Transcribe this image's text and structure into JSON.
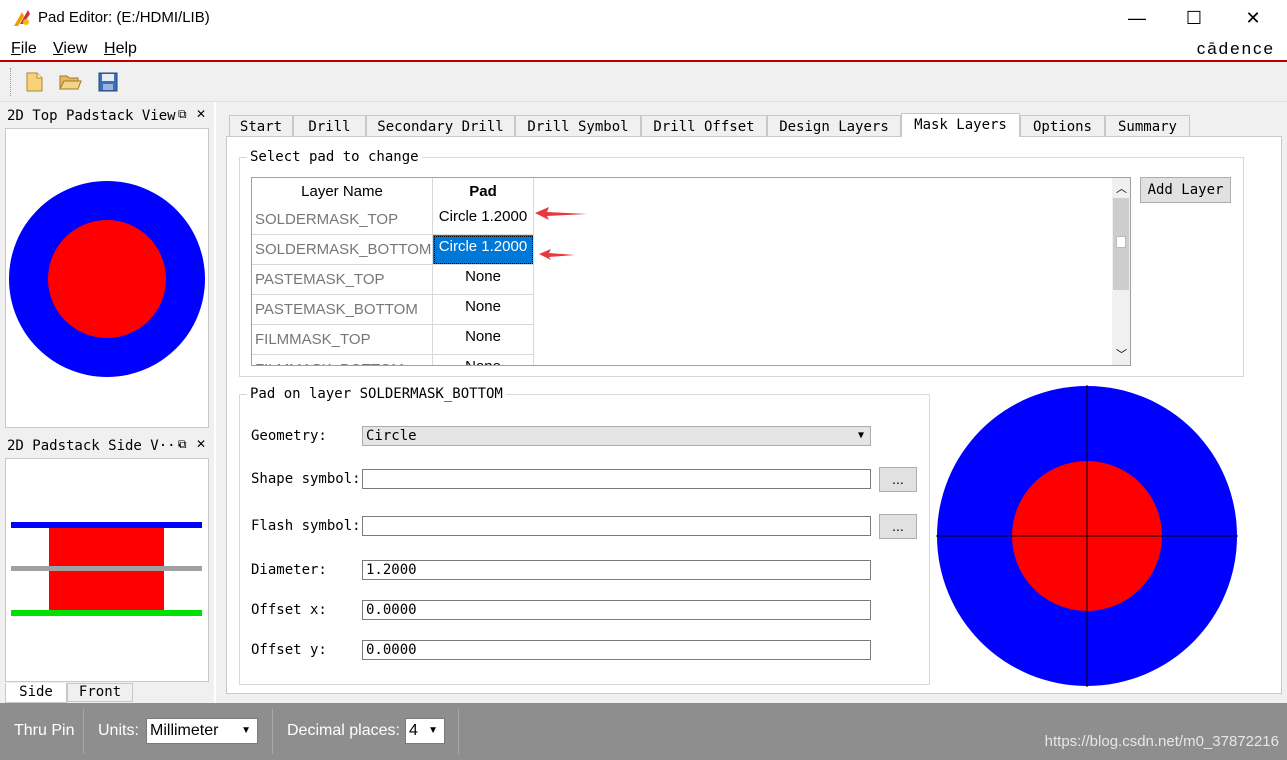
{
  "window": {
    "title": "Pad Editor:  (E:/HDMI/LIB)",
    "minimize_glyph": "—",
    "maximize_glyph": "☐",
    "close_glyph": "✕"
  },
  "menu": {
    "items": [
      {
        "mnemonic": "F",
        "rest": "ile"
      },
      {
        "mnemonic": "V",
        "rest": "iew"
      },
      {
        "mnemonic": "H",
        "rest": "elp"
      }
    ],
    "brand": "cādence"
  },
  "toolbar": {
    "icons": [
      "new-file-icon",
      "open-folder-icon",
      "save-icon"
    ]
  },
  "docks": {
    "top_view": {
      "title": "2D Top Padstack View",
      "float_glyph": "⧉",
      "close_glyph": "✕"
    },
    "side_view": {
      "title": "2D Padstack Side V···",
      "float_glyph": "⧉",
      "close_glyph": "✕"
    },
    "side_tabs": [
      "Side",
      "Front"
    ]
  },
  "tabs": [
    {
      "label": "Start"
    },
    {
      "label": "Drill"
    },
    {
      "label": "Secondary Drill"
    },
    {
      "label": "Drill Symbol"
    },
    {
      "label": "Drill Offset"
    },
    {
      "label": "Design Layers"
    },
    {
      "label": "Mask Layers",
      "active": true
    },
    {
      "label": "Options"
    },
    {
      "label": "Summary"
    }
  ],
  "select_pad": {
    "group_label": "Select pad to change",
    "col_layer_name": "Layer Name",
    "col_pad": "Pad",
    "rows": [
      {
        "layer": "SOLDERMASK_TOP",
        "pad": "Circle 1.2000"
      },
      {
        "layer": "SOLDERMASK_BOTTOM",
        "pad": "Circle 1.2000",
        "selected": true
      },
      {
        "layer": "PASTEMASK_TOP",
        "pad": "None"
      },
      {
        "layer": "PASTEMASK_BOTTOM",
        "pad": "None"
      },
      {
        "layer": "FILMMASK_TOP",
        "pad": "None"
      },
      {
        "layer": "FILMMASK_BOTTOM",
        "pad": "None"
      }
    ],
    "add_layer_label": "Add Layer"
  },
  "pad_on_layer": {
    "group_label": "Pad on layer SOLDERMASK_BOTTOM",
    "geometry_label": "Geometry:",
    "geometry_value": "Circle",
    "shape_symbol_label": "Shape symbol:",
    "shape_symbol_value": "",
    "flash_symbol_label": "Flash symbol:",
    "flash_symbol_value": "",
    "browse_label": "...",
    "diameter_label": "Diameter:",
    "diameter_value": "1.2000",
    "offset_x_label": "Offset x:",
    "offset_x_value": "0.0000",
    "offset_y_label": "Offset y:",
    "offset_y_value": "0.0000"
  },
  "status": {
    "mode": "Thru Pin",
    "units_label": "Units:",
    "units_value": "Millimeter",
    "decimal_label": "Decimal places:",
    "decimal_value": "4",
    "watermark": "https://blog.csdn.net/m0_37872216"
  },
  "colors": {
    "pad_outer": "#0000ff",
    "pad_inner": "#ff0000",
    "side_top_layer": "#0000ff",
    "side_mid_layer": "#a0a0a0",
    "side_bottom_layer": "#00e000",
    "annotation_arrow": "#e8383d",
    "selection": "#0078d7"
  }
}
